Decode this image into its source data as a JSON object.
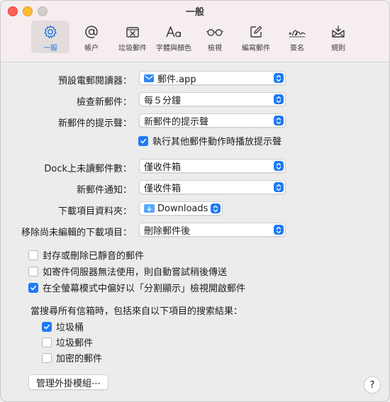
{
  "window": {
    "title": "一般"
  },
  "toolbar": {
    "items": [
      {
        "label": "一般",
        "icon": "gear-icon",
        "active": true
      },
      {
        "label": "帳户",
        "icon": "at-icon"
      },
      {
        "label": "垃圾郵件",
        "icon": "junk-tray-icon"
      },
      {
        "label": "字體與顏色",
        "icon": "font-icon"
      },
      {
        "label": "檢視",
        "icon": "glasses-icon"
      },
      {
        "label": "編寫郵件",
        "icon": "compose-icon"
      },
      {
        "label": "簽名",
        "icon": "signature-icon"
      },
      {
        "label": "規則",
        "icon": "rules-envelope-icon"
      }
    ]
  },
  "settings": {
    "default_reader": {
      "label": "預設電郵閱讀器：",
      "value": "郵件.app"
    },
    "check_mail": {
      "label": "檢查新郵件：",
      "value": "每５分鐘"
    },
    "new_mail_sound": {
      "label": "新郵件的提示聲：",
      "value": "新郵件的提示聲"
    },
    "play_sounds_checkbox": {
      "label": "執行其他郵件動作時播放提示聲",
      "checked": true
    },
    "dock_unread": {
      "label": "Dock上未讀郵件數：",
      "value": "僅收件箱"
    },
    "new_mail_notifications": {
      "label": "新郵件通知：",
      "value": "僅收件箱"
    },
    "downloads_folder": {
      "label": "下載項目資料夾：",
      "value": "Downloads"
    },
    "remove_downloads": {
      "label": "移除尚未編輯的下載項目：",
      "value": "刪除郵件後"
    }
  },
  "options": [
    {
      "label": "封存或刪除已靜音的郵件",
      "checked": false
    },
    {
      "label": "如寄件伺服器無法使用，則自動嘗試稍後傳送",
      "checked": false
    },
    {
      "label": "在全螢幕模式中偏好以「分割顯示」檢視開啟郵件",
      "checked": true
    }
  ],
  "search": {
    "heading": "當搜尋所有信箱時，包括來自以下項目的搜索結果：",
    "items": [
      {
        "label": "垃圾桶",
        "checked": true
      },
      {
        "label": "垃圾郵件",
        "checked": false
      },
      {
        "label": "加密的郵件",
        "checked": false
      }
    ]
  },
  "buttons": {
    "manage_plugins": "管理外掛模組⋯",
    "help": "?"
  },
  "colors": {
    "accent": "#1f7af4",
    "titlebar": "#f6eeee",
    "background": "#ececec"
  }
}
